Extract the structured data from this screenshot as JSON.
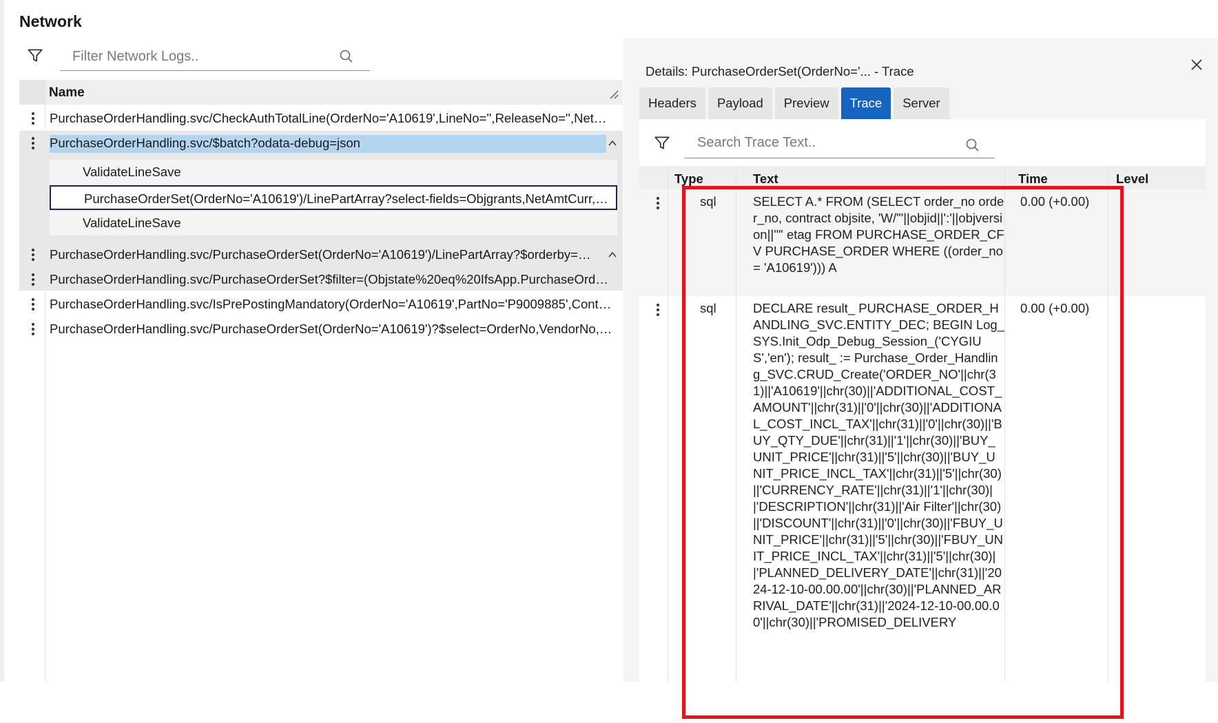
{
  "page": {
    "title": "Network"
  },
  "left_search": {
    "placeholder": "Filter Network Logs.."
  },
  "list": {
    "column_header": "Name",
    "rows": [
      {
        "name": "PurchaseOrderHandling.svc/CheckAuthTotalLine(OrderNo='A10619',LineNo='',ReleaseNo='',NetAmountCurr=…"
      },
      {
        "name": "PurchaseOrderHandling.svc/$batch?odata-debug=json",
        "children": [
          "ValidateLineSave",
          "PurchaseOrderSet(OrderNo='A10619')/LinePartArray?select-fields=Objgrants,NetAmtCurr,PartNo…",
          "ValidateLineSave"
        ]
      },
      {
        "name": "PurchaseOrderHandling.svc/PurchaseOrderSet(OrderNo='A10619')/LinePartArray?$orderby=Li…"
      },
      {
        "name": "PurchaseOrderHandling.svc/PurchaseOrderSet?$filter=(Objstate%20eq%20IfsApp.PurchaseOrde…"
      },
      {
        "name": "PurchaseOrderHandling.svc/IsPrePostingMandatory(OrderNo='A10619',PartNo='P9009885',Cont…"
      },
      {
        "name": "PurchaseOrderHandling.svc/PurchaseOrderSet(OrderNo='A10619')?$select=OrderNo,VendorNo,…"
      }
    ]
  },
  "details": {
    "title": "Details: PurchaseOrderSet(OrderNo='...  - Trace",
    "tabs": [
      "Headers",
      "Payload",
      "Preview",
      "Trace",
      "Server"
    ],
    "active_tab": "Trace",
    "search": {
      "placeholder": "Search Trace Text.."
    },
    "columns": {
      "type": "Type",
      "text": "Text",
      "time": "Time",
      "level": "Level"
    },
    "rows": [
      {
        "type": "sql",
        "text": "SELECT A.* FROM (SELECT order_no order_no, contract objsite, 'W/\"'||objid||':'||objversion||'\"' etag FROM PURCHASE_ORDER_CFV PURCHASE_ORDER WHERE ((order_no = 'A10619'))) A",
        "time": "0.00 (+0.00)"
      },
      {
        "type": "sql",
        "text": "DECLARE result_ PURCHASE_ORDER_HANDLING_SVC.ENTITY_DEC; BEGIN Log_SYS.Init_Odp_Debug_Session_('CYGIUS','en'); result_ := Purchase_Order_Handling_SVC.CRUD_Create('ORDER_NO'||chr(31)||'A10619'||chr(30)||'ADDITIONAL_COST_AMOUNT'||chr(31)||'0'||chr(30)||'ADDITIONAL_COST_INCL_TAX'||chr(31)||'0'||chr(30)||'BUY_QTY_DUE'||chr(31)||'1'||chr(30)||'BUY_UNIT_PRICE'||chr(31)||'5'||chr(30)||'BUY_UNIT_PRICE_INCL_TAX'||chr(31)||'5'||chr(30)||'CURRENCY_RATE'||chr(31)||'1'||chr(30)||'DESCRIPTION'||chr(31)||'Air Filter'||chr(30)||'DISCOUNT'||chr(31)||'0'||chr(30)||'FBUY_UNIT_PRICE'||chr(31)||'5'||chr(30)||'FBUY_UNIT_PRICE_INCL_TAX'||chr(31)||'5'||chr(30)||'PLANNED_DELIVERY_DATE'||chr(31)||'2024-12-10-00.00.00'||chr(30)||'PLANNED_ARRIVAL_DATE'||chr(31)||'2024-12-10-00.00.00'||chr(30)||'PROMISED_DELIVERY",
        "time": "0.00 (+0.00)"
      }
    ]
  },
  "colors": {
    "accent": "#1565c0",
    "selection": "#b4d5f0",
    "highlight": "#e0161b"
  }
}
